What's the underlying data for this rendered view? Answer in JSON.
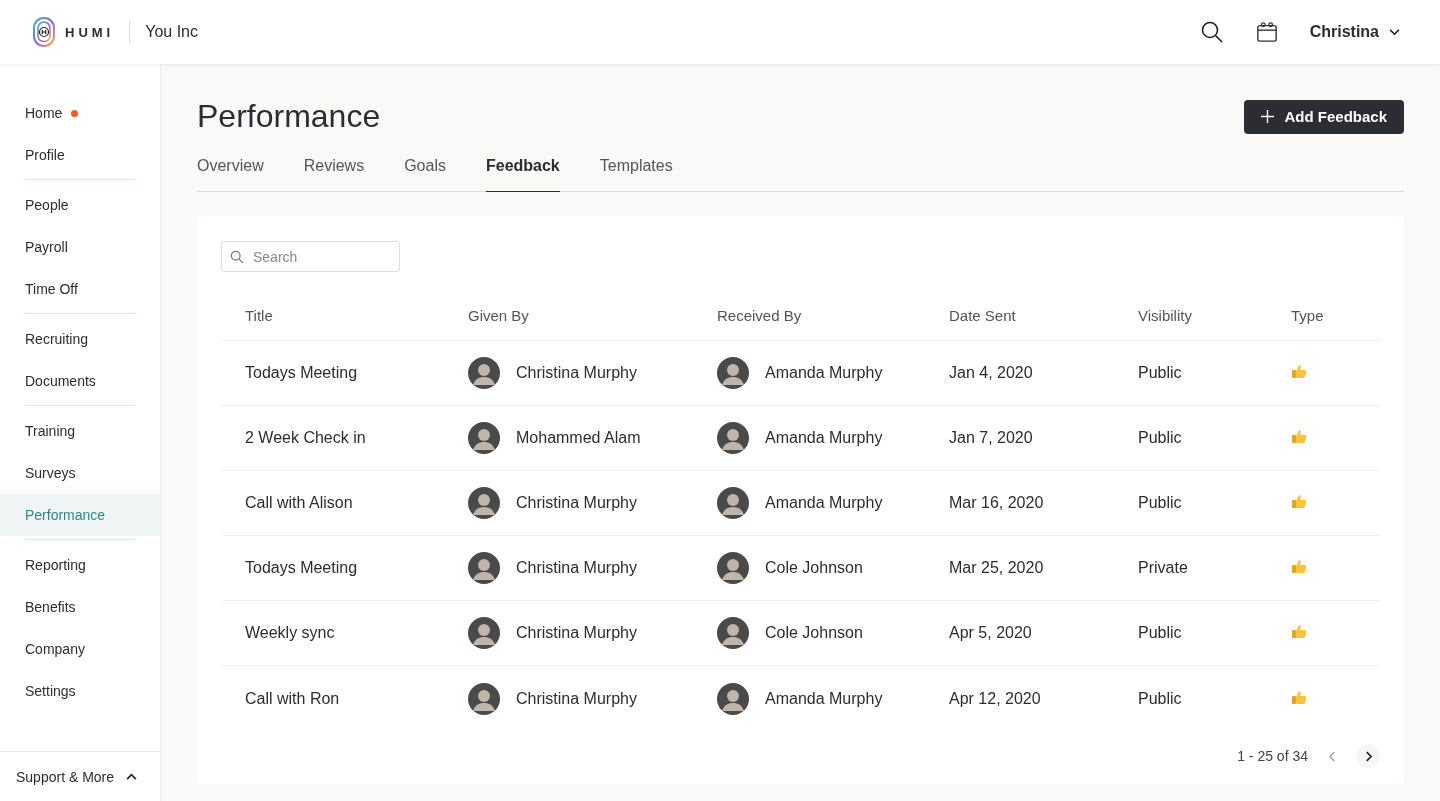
{
  "header": {
    "brand": "HUMI",
    "company": "You Inc",
    "user": "Christina"
  },
  "sidebar": {
    "groups": [
      [
        {
          "label": "Home",
          "notification": true,
          "selected": false
        },
        {
          "label": "Profile",
          "notification": false,
          "selected": false
        }
      ],
      [
        {
          "label": "People",
          "notification": false,
          "selected": false
        },
        {
          "label": "Payroll",
          "notification": false,
          "selected": false
        },
        {
          "label": "Time Off",
          "notification": false,
          "selected": false
        }
      ],
      [
        {
          "label": "Recruiting",
          "notification": false,
          "selected": false
        },
        {
          "label": "Documents",
          "notification": false,
          "selected": false
        }
      ],
      [
        {
          "label": "Training",
          "notification": false,
          "selected": false
        },
        {
          "label": "Surveys",
          "notification": false,
          "selected": false
        },
        {
          "label": "Performance",
          "notification": false,
          "selected": true
        }
      ],
      [
        {
          "label": "Reporting",
          "notification": false,
          "selected": false
        },
        {
          "label": "Benefits",
          "notification": false,
          "selected": false
        },
        {
          "label": "Company",
          "notification": false,
          "selected": false
        },
        {
          "label": "Settings",
          "notification": false,
          "selected": false
        }
      ]
    ],
    "footer": "Support & More"
  },
  "page": {
    "title": "Performance",
    "action": "Add Feedback"
  },
  "tabs": [
    {
      "label": "Overview",
      "selected": false
    },
    {
      "label": "Reviews",
      "selected": false
    },
    {
      "label": "Goals",
      "selected": false
    },
    {
      "label": "Feedback",
      "selected": true
    },
    {
      "label": "Templates",
      "selected": false
    }
  ],
  "search": {
    "placeholder": "Search"
  },
  "table": {
    "columns": [
      "Title",
      "Given By",
      "Received By",
      "Date Sent",
      "Visibility",
      "Type"
    ],
    "rows": [
      {
        "title": "Todays Meeting",
        "given_by": "Christina Murphy",
        "received_by": "Amanda Murphy",
        "date_sent": "Jan 4, 2020",
        "visibility": "Public"
      },
      {
        "title": "2 Week Check in",
        "given_by": "Mohammed Alam",
        "received_by": "Amanda Murphy",
        "date_sent": "Jan 7, 2020",
        "visibility": "Public"
      },
      {
        "title": "Call with Alison",
        "given_by": "Christina Murphy",
        "received_by": "Amanda Murphy",
        "date_sent": "Mar 16, 2020",
        "visibility": "Public"
      },
      {
        "title": "Todays Meeting",
        "given_by": "Christina Murphy",
        "received_by": "Cole Johnson",
        "date_sent": "Mar 25, 2020",
        "visibility": "Private"
      },
      {
        "title": "Weekly sync",
        "given_by": "Christina Murphy",
        "received_by": "Cole Johnson",
        "date_sent": "Apr 5, 2020",
        "visibility": "Public"
      },
      {
        "title": "Call with Ron",
        "given_by": "Christina Murphy",
        "received_by": "Amanda Murphy",
        "date_sent": "Apr 12, 2020",
        "visibility": "Public"
      }
    ]
  },
  "pagination": {
    "range": "1 - 25 of 34"
  }
}
